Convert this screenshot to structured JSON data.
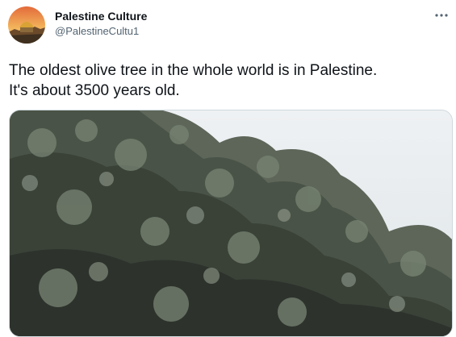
{
  "tweet": {
    "author": {
      "name": "Palestine Culture",
      "handle": "@PalestineCultu1"
    },
    "text_lines": [
      "The oldest olive tree in the whole world is in Palestine.",
      "It's about 3500 years old."
    ],
    "more_icon": "ellipsis-icon",
    "media": {
      "type": "photo",
      "subject": "olive tree canopy under a pale sky"
    }
  },
  "colors": {
    "text": "#0f1419",
    "secondary_text": "#536471",
    "border": "#cfd9de"
  }
}
